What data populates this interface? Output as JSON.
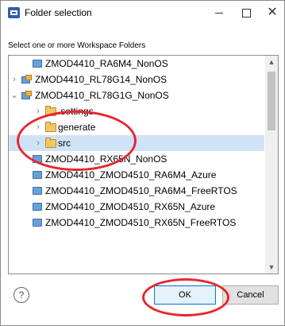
{
  "window": {
    "title": "Folder selection",
    "controls": {
      "minimize": "—",
      "maximize": "☐",
      "close": "✕"
    }
  },
  "prompt": "Select one or more Workspace Folders",
  "tree": {
    "rows": [
      {
        "label": "ZMOD4410_RA6M4_NonOS"
      },
      {
        "label": "ZMOD4410_RL78G14_NonOS"
      },
      {
        "label": "ZMOD4410_RL78G1G_NonOS"
      },
      {
        "label": ".settings"
      },
      {
        "label": "generate"
      },
      {
        "label": "src"
      },
      {
        "label": "ZMOD4410_RX65N_NonOS"
      },
      {
        "label": "ZMOD4410_ZMOD4510_RA6M4_Azure"
      },
      {
        "label": "ZMOD4410_ZMOD4510_RA6M4_FreeRTOS"
      },
      {
        "label": "ZMOD4410_ZMOD4510_RX65N_Azure"
      },
      {
        "label": "ZMOD4410_ZMOD4510_RX65N_FreeRTOS"
      }
    ],
    "expand_glyphs": {
      "collapsed": "›",
      "expanded": "⌄"
    },
    "scroll": {
      "up": "▲",
      "down": "▼"
    }
  },
  "buttons": {
    "help": "?",
    "ok": "OK",
    "cancel": "Cancel"
  },
  "colors": {
    "selection": "#cfe3f7",
    "annotation": "#e8262d",
    "project_icon": "#6aa0d8",
    "folder_icon": "#f0c862"
  }
}
